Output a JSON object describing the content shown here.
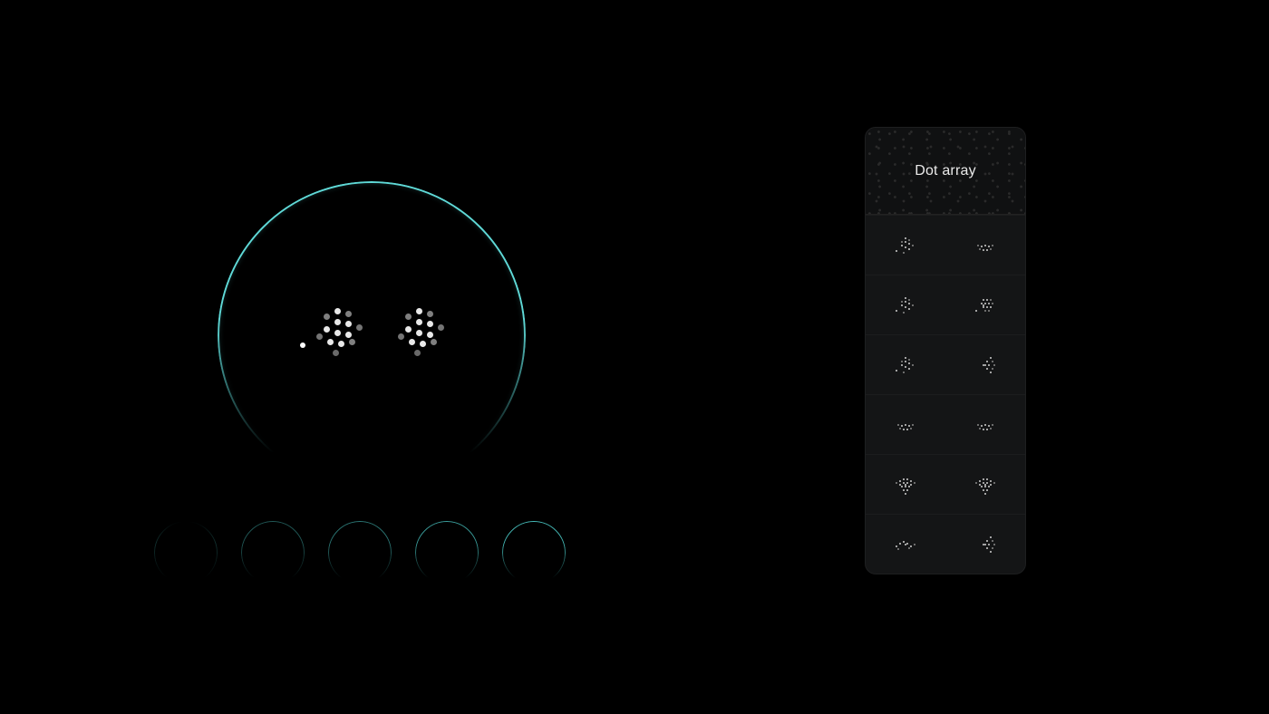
{
  "panel": {
    "title": "Dot array",
    "rows": [
      {
        "left": "cluster-dots-icon",
        "right": "dash-dots-icon"
      },
      {
        "left": "cluster-dots-icon",
        "right": "block-dots-icon"
      },
      {
        "left": "cluster-dots-icon",
        "right": "arrow-left-dots-icon"
      },
      {
        "left": "dash-dots-icon",
        "right": "dash-dots-icon"
      },
      {
        "left": "heart-dots-icon",
        "right": "heart-dots-icon"
      },
      {
        "left": "wave-dots-icon",
        "right": "arrow-left-dots-icon"
      }
    ]
  },
  "face": {
    "eye_pattern": "cluster-dots-icon"
  },
  "ring_strip": {
    "count": 5
  },
  "colors": {
    "ring": "#5fd9d7",
    "panel_bg": "#141516",
    "dot": "#cfcfcf"
  }
}
